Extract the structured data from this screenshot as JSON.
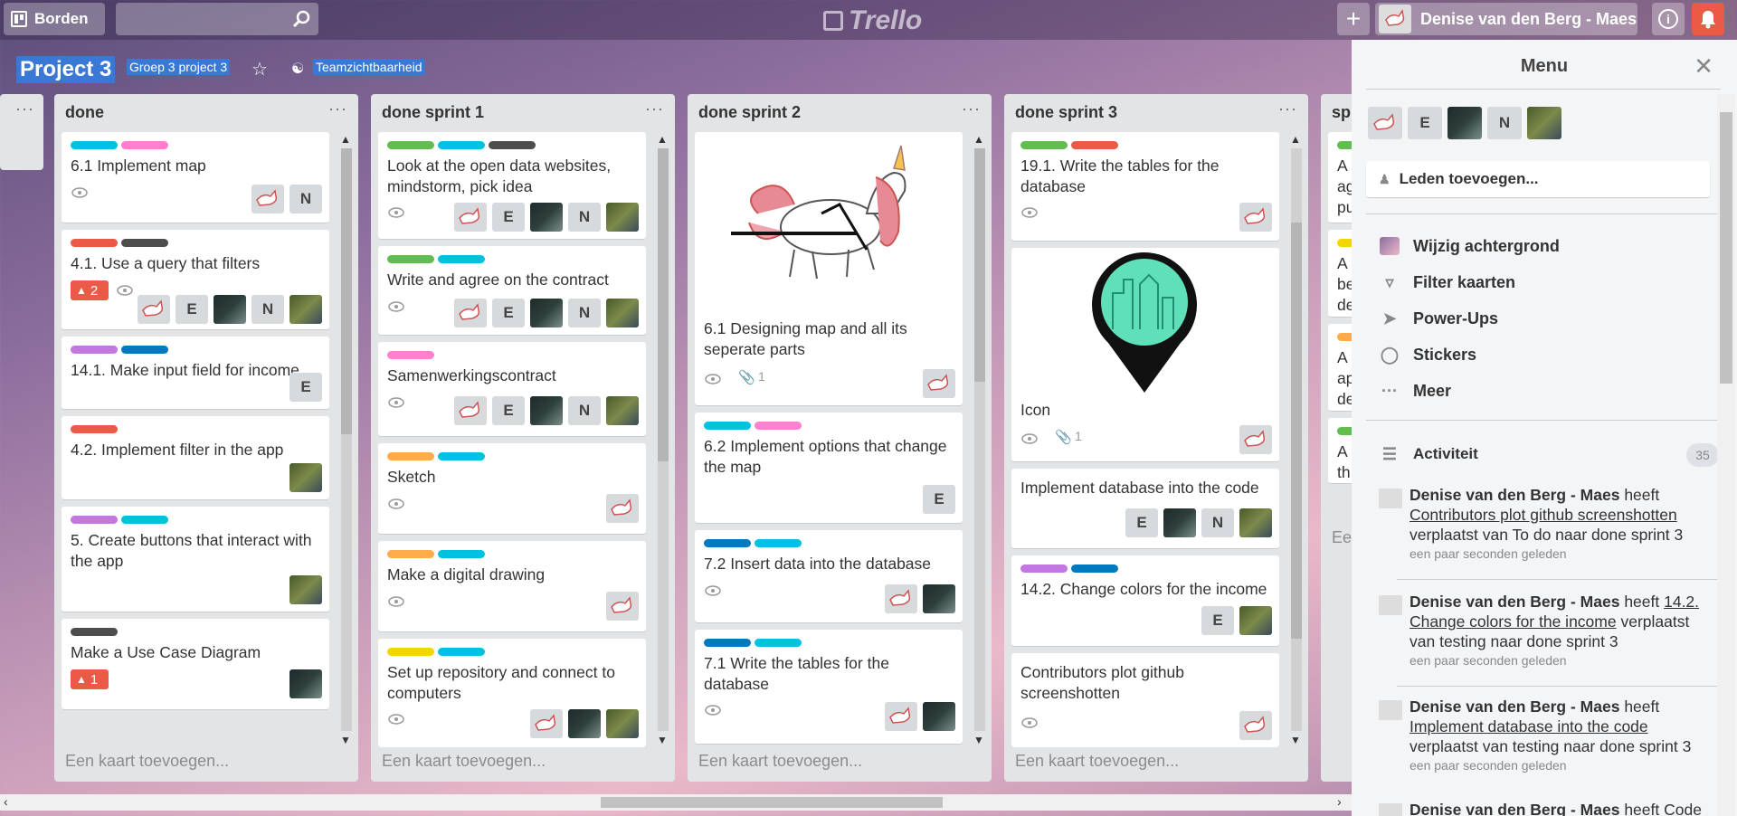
{
  "topbar": {
    "boards_label": "Borden",
    "logo_text": "Trello",
    "user_name": "Denise van den Berg - Maes",
    "icons": [
      "board-icon",
      "search-icon",
      "plus-icon",
      "info-icon",
      "bell-icon"
    ]
  },
  "board": {
    "title": "Project 3",
    "team": "Groep 3 project 3",
    "visibility": "Teamzichtbaarheid"
  },
  "lists": [
    {
      "title": "done",
      "add_label": "Een kaart toevoegen...",
      "cards": [
        {
          "title": "6.1 Implement map"
        },
        {
          "title": "4.1. Use a query that filters",
          "badge": "2"
        },
        {
          "title": "14.1. Make input field for income"
        },
        {
          "title": "4.2. Implement filter in the app"
        },
        {
          "title": "5. Create buttons that interact with the app"
        },
        {
          "title": "Make a Use Case Diagram",
          "badge": "1"
        }
      ]
    },
    {
      "title": "done sprint 1",
      "add_label": "Een kaart toevoegen...",
      "cards": [
        {
          "title": "Look at the open data websites, mindstorm, pick idea"
        },
        {
          "title": "Write and agree on the contract"
        },
        {
          "title": "Samenwerkingscontract"
        },
        {
          "title": "Sketch"
        },
        {
          "title": "Make a digital drawing"
        },
        {
          "title": "Set up repository and connect to computers"
        }
      ]
    },
    {
      "title": "done sprint 2",
      "add_label": "Een kaart toevoegen...",
      "cards": [
        {
          "title": "6.1 Designing map and all its seperate parts",
          "attachments": "1"
        },
        {
          "title": "6.2 Implement options that change the map"
        },
        {
          "title": "7.2 Insert data into the database"
        },
        {
          "title": "7.1 Write the tables for the database"
        }
      ]
    },
    {
      "title": "done sprint 3",
      "add_label": "Een kaart toevoegen...",
      "cards": [
        {
          "title": "19.1. Write the tables for the database"
        },
        {
          "title": "Icon",
          "attachments": "1"
        },
        {
          "title": "Implement database into the code"
        },
        {
          "title": "14.2. Change colors for the income"
        },
        {
          "title": "Contributors plot github screenshotten"
        }
      ]
    },
    {
      "title": "sp",
      "add_label": "Ee",
      "cards": [
        {
          "title": "A ag pu"
        },
        {
          "title": "A be de"
        },
        {
          "title": "A ap de"
        },
        {
          "title": "A th"
        }
      ]
    }
  ],
  "members": {
    "initial_e": "E",
    "initial_n": "N"
  },
  "menu": {
    "title": "Menu",
    "add_members": "Leden toevoegen...",
    "items": [
      "Wijzig achtergrond",
      "Filter kaarten",
      "Power-Ups",
      "Stickers",
      "Meer"
    ],
    "activity_label": "Activiteit",
    "activity_count": "35",
    "activities": [
      {
        "who": "Denise van den Berg - Maes",
        "pre": " heeft ",
        "link": "Contributors plot github screenshotten",
        "post": " verplaatst van To do naar done sprint 3",
        "time": "een paar seconden geleden"
      },
      {
        "who": "Denise van den Berg - Maes",
        "pre": " heeft ",
        "link": "14.2. Change colors for the income",
        "post": " verplaatst van testing naar done sprint 3",
        "time": "een paar seconden geleden"
      },
      {
        "who": "Denise van den Berg - Maes",
        "pre": " heeft ",
        "link": "Implement database into the code",
        "post": " verplaatst van testing naar done sprint 3",
        "time": "een paar seconden geleden"
      },
      {
        "who": "Denise van den Berg - Maes",
        "pre": " heeft Code",
        "link": "",
        "post": "",
        "time": ""
      }
    ]
  },
  "colors": {
    "green": "#61bd4f",
    "yellow": "#f2d600",
    "orange": "#ffab4a",
    "red": "#eb5a46",
    "purple": "#c377e0",
    "blue": "#0079bf",
    "sky": "#00c2e0",
    "pink": "#ff80ce",
    "black": "#4d4d4d"
  }
}
